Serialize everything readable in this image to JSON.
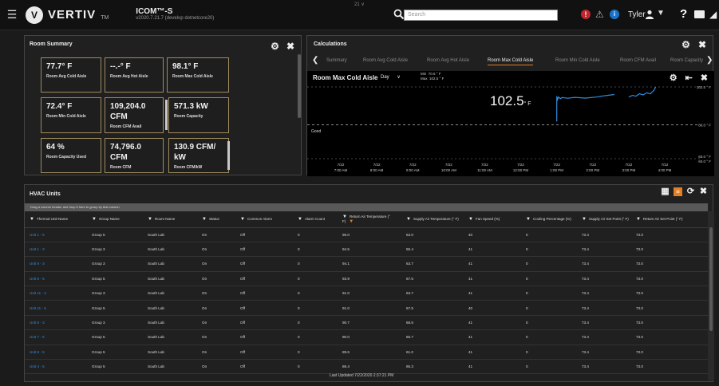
{
  "header": {
    "brand": "VERTIV",
    "brand_tm": "TM",
    "app_title": "ICOM™-S",
    "app_version": "v2020.7.21.7 (develop dotnetcore20)",
    "mini_tag": "21 ∨",
    "search_placeholder": "Search",
    "alert_glyph": "!",
    "warn_glyph": "⚠",
    "info_glyph": "i",
    "user_name": "Tyler",
    "user_caret": "▼",
    "help_glyph": "?",
    "chart_glyph": "◢"
  },
  "room_summary": {
    "title": "Room Summary",
    "settings_glyph": "⚙",
    "expand_glyph": "✖",
    "tiles": [
      {
        "value": "77.7° F",
        "label": "Room Avg Cold Aisle"
      },
      {
        "value": "--.-° F",
        "label": "Room Avg Hot Aisle"
      },
      {
        "value": "98.1° F",
        "label": "Room Max Cold Aisle"
      },
      {
        "value": "72.4° F",
        "label": "Room Min Cold Aisle"
      },
      {
        "value": "109,204.0 CFM",
        "label": "Room CFM Avail"
      },
      {
        "value": "571.3 kW",
        "label": "Room Capacity"
      },
      {
        "value": "64 %",
        "label": "Room Capacity Used"
      },
      {
        "value": "74,796.0 CFM",
        "label": "Room CFM"
      },
      {
        "value": "130.9 CFM/ kW",
        "label": "Room CFM/kW"
      }
    ]
  },
  "calculations": {
    "title": "Calculations",
    "settings_glyph": "⚙",
    "expand_glyph": "✖",
    "prev_glyph": "❮",
    "next_glyph": "❯",
    "tabs": [
      "Summary",
      "Room Avg Cold Aisle",
      "Room Avg Hot Aisle",
      "Room Max Cold Aisle",
      "Room Min Cold Aisle",
      "Room CFM Avail",
      "Room Capacity"
    ],
    "active_tab": 3,
    "chart": {
      "title": "Room Max Cold Aisle",
      "range": "Day",
      "range_caret": "∨",
      "min_label": "Min",
      "min_value": "70.6 ° F",
      "max_label": "Max",
      "max_value": "102.5 ° F",
      "current_value": "102.5",
      "current_unit": "° F",
      "good_label": "Good",
      "settings_glyph": "⚙",
      "export_glyph": "⇤",
      "close_glyph": "✖"
    }
  },
  "chart_data": {
    "type": "line",
    "title": "Room Max Cold Aisle",
    "x_dates": [
      "7/22",
      "7/22",
      "7/22",
      "7/22",
      "7/22",
      "7/22",
      "7/22",
      "7/22",
      "7/22",
      "7/22"
    ],
    "x_times": [
      "7:00 AM",
      "8:00 AM",
      "9:00 AM",
      "10:00 AM",
      "11:00 AM",
      "12:00 PM",
      "1:00 PM",
      "2:00 PM",
      "3:00 PM",
      "4:00 PM"
    ],
    "y_tick_labels": [
      "102.5 ° F",
      "80.0 ° F",
      "60.0 ° F",
      "60.0 ° F"
    ],
    "ylim": [
      60,
      102.5
    ],
    "good_threshold": 80.0,
    "series": [
      {
        "color": "#2f8ee0",
        "x_hours": [
          13.0,
          13.0,
          13.02,
          13.05,
          13.1,
          13.15,
          13.3,
          13.5,
          13.8,
          14.1,
          14.3,
          14.6
        ],
        "values": [
          82,
          97,
          95,
          96.5,
          95.5,
          96.2,
          95.8,
          96.3,
          95.9,
          96.5,
          97.2,
          98.0
        ]
      },
      {
        "color": "#2f8ee0",
        "x_hours": [
          15.0,
          15.1,
          15.2,
          15.3,
          15.4,
          15.5,
          15.6,
          15.7,
          15.75
        ],
        "values": [
          96.5,
          97.5,
          97.0,
          98.5,
          97.8,
          99.0,
          98.4,
          100.5,
          102.5
        ]
      }
    ],
    "grid": false
  },
  "hvac": {
    "title": "HVAC Units",
    "group_hint": "Drag a column header and drop it here to group by that column",
    "icon_chart": "▦",
    "icon_list": "≡",
    "icon_refresh": "⟳",
    "icon_close": "✖",
    "filter_glyph": "▼",
    "sort_glyph": "▼",
    "columns": [
      "Thermal Unit Name",
      "Group Name",
      "Room Name",
      "Status",
      "Common Alarm",
      "Alarm Count",
      "Return Air Temperature (° F)",
      "Supply Air Temperature (° F)",
      "Fan Speed (%)",
      "Cooling Percentage (%)",
      "Supply Air Set Point (° F)",
      "Return Air Set Point (° F)"
    ],
    "rows": [
      [
        "Unit 1 - 5",
        "Group 5",
        "South Lab",
        "On",
        "Off",
        "0",
        "95.0",
        "63.0",
        "40",
        "0",
        "73.4",
        "73.0"
      ],
      [
        "Unit 1 - 3",
        "Group 3",
        "South Lab",
        "On",
        "Off",
        "0",
        "94.5",
        "55.4",
        "41",
        "0",
        "73.4",
        "73.0"
      ],
      [
        "Unit 9 - 3",
        "Group 3",
        "South Lab",
        "On",
        "Off",
        "0",
        "94.1",
        "63.7",
        "41",
        "0",
        "73.4",
        "73.0"
      ],
      [
        "Unit 6 - 5",
        "Group 5",
        "South Lab",
        "On",
        "Off",
        "0",
        "93.9",
        "67.5",
        "41",
        "0",
        "73.4",
        "73.0"
      ],
      [
        "Unit 11 - 3",
        "Group 3",
        "South Lab",
        "On",
        "Off",
        "0",
        "91.0",
        "63.7",
        "41",
        "0",
        "73.4",
        "73.0"
      ],
      [
        "Unit 11 - 5",
        "Group 5",
        "South Lab",
        "On",
        "Off",
        "0",
        "91.0",
        "67.5",
        "40",
        "0",
        "73.4",
        "73.0"
      ],
      [
        "Unit 6 - 3",
        "Group 3",
        "South Lab",
        "On",
        "Off",
        "0",
        "90.7",
        "68.5",
        "41",
        "0",
        "73.4",
        "73.0"
      ],
      [
        "Unit 7 - 5",
        "Group 5",
        "South Lab",
        "On",
        "Off",
        "0",
        "90.0",
        "65.7",
        "41",
        "0",
        "73.4",
        "73.0"
      ],
      [
        "Unit 8 - 5",
        "Group 5",
        "South Lab",
        "On",
        "Off",
        "0",
        "89.6",
        "61.0",
        "41",
        "0",
        "73.4",
        "73.0"
      ],
      [
        "Unit 4 - 5",
        "Group 5",
        "South Lab",
        "On",
        "Off",
        "0",
        "86.4",
        "65.3",
        "41",
        "0",
        "73.4",
        "73.0"
      ]
    ],
    "last_updated": "Last Updated 7/22/2020 2:37:21 PM"
  }
}
